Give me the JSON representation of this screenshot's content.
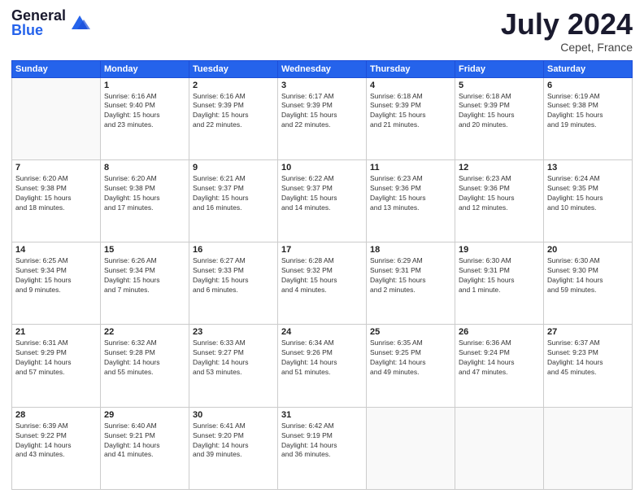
{
  "header": {
    "logo_general": "General",
    "logo_blue": "Blue",
    "month_title": "July 2024",
    "location": "Cepet, France"
  },
  "weekdays": [
    "Sunday",
    "Monday",
    "Tuesday",
    "Wednesday",
    "Thursday",
    "Friday",
    "Saturday"
  ],
  "weeks": [
    [
      {
        "day": "",
        "info": ""
      },
      {
        "day": "1",
        "info": "Sunrise: 6:16 AM\nSunset: 9:40 PM\nDaylight: 15 hours\nand 23 minutes."
      },
      {
        "day": "2",
        "info": "Sunrise: 6:16 AM\nSunset: 9:39 PM\nDaylight: 15 hours\nand 22 minutes."
      },
      {
        "day": "3",
        "info": "Sunrise: 6:17 AM\nSunset: 9:39 PM\nDaylight: 15 hours\nand 22 minutes."
      },
      {
        "day": "4",
        "info": "Sunrise: 6:18 AM\nSunset: 9:39 PM\nDaylight: 15 hours\nand 21 minutes."
      },
      {
        "day": "5",
        "info": "Sunrise: 6:18 AM\nSunset: 9:39 PM\nDaylight: 15 hours\nand 20 minutes."
      },
      {
        "day": "6",
        "info": "Sunrise: 6:19 AM\nSunset: 9:38 PM\nDaylight: 15 hours\nand 19 minutes."
      }
    ],
    [
      {
        "day": "7",
        "info": "Sunrise: 6:20 AM\nSunset: 9:38 PM\nDaylight: 15 hours\nand 18 minutes."
      },
      {
        "day": "8",
        "info": "Sunrise: 6:20 AM\nSunset: 9:38 PM\nDaylight: 15 hours\nand 17 minutes."
      },
      {
        "day": "9",
        "info": "Sunrise: 6:21 AM\nSunset: 9:37 PM\nDaylight: 15 hours\nand 16 minutes."
      },
      {
        "day": "10",
        "info": "Sunrise: 6:22 AM\nSunset: 9:37 PM\nDaylight: 15 hours\nand 14 minutes."
      },
      {
        "day": "11",
        "info": "Sunrise: 6:23 AM\nSunset: 9:36 PM\nDaylight: 15 hours\nand 13 minutes."
      },
      {
        "day": "12",
        "info": "Sunrise: 6:23 AM\nSunset: 9:36 PM\nDaylight: 15 hours\nand 12 minutes."
      },
      {
        "day": "13",
        "info": "Sunrise: 6:24 AM\nSunset: 9:35 PM\nDaylight: 15 hours\nand 10 minutes."
      }
    ],
    [
      {
        "day": "14",
        "info": "Sunrise: 6:25 AM\nSunset: 9:34 PM\nDaylight: 15 hours\nand 9 minutes."
      },
      {
        "day": "15",
        "info": "Sunrise: 6:26 AM\nSunset: 9:34 PM\nDaylight: 15 hours\nand 7 minutes."
      },
      {
        "day": "16",
        "info": "Sunrise: 6:27 AM\nSunset: 9:33 PM\nDaylight: 15 hours\nand 6 minutes."
      },
      {
        "day": "17",
        "info": "Sunrise: 6:28 AM\nSunset: 9:32 PM\nDaylight: 15 hours\nand 4 minutes."
      },
      {
        "day": "18",
        "info": "Sunrise: 6:29 AM\nSunset: 9:31 PM\nDaylight: 15 hours\nand 2 minutes."
      },
      {
        "day": "19",
        "info": "Sunrise: 6:30 AM\nSunset: 9:31 PM\nDaylight: 15 hours\nand 1 minute."
      },
      {
        "day": "20",
        "info": "Sunrise: 6:30 AM\nSunset: 9:30 PM\nDaylight: 14 hours\nand 59 minutes."
      }
    ],
    [
      {
        "day": "21",
        "info": "Sunrise: 6:31 AM\nSunset: 9:29 PM\nDaylight: 14 hours\nand 57 minutes."
      },
      {
        "day": "22",
        "info": "Sunrise: 6:32 AM\nSunset: 9:28 PM\nDaylight: 14 hours\nand 55 minutes."
      },
      {
        "day": "23",
        "info": "Sunrise: 6:33 AM\nSunset: 9:27 PM\nDaylight: 14 hours\nand 53 minutes."
      },
      {
        "day": "24",
        "info": "Sunrise: 6:34 AM\nSunset: 9:26 PM\nDaylight: 14 hours\nand 51 minutes."
      },
      {
        "day": "25",
        "info": "Sunrise: 6:35 AM\nSunset: 9:25 PM\nDaylight: 14 hours\nand 49 minutes."
      },
      {
        "day": "26",
        "info": "Sunrise: 6:36 AM\nSunset: 9:24 PM\nDaylight: 14 hours\nand 47 minutes."
      },
      {
        "day": "27",
        "info": "Sunrise: 6:37 AM\nSunset: 9:23 PM\nDaylight: 14 hours\nand 45 minutes."
      }
    ],
    [
      {
        "day": "28",
        "info": "Sunrise: 6:39 AM\nSunset: 9:22 PM\nDaylight: 14 hours\nand 43 minutes."
      },
      {
        "day": "29",
        "info": "Sunrise: 6:40 AM\nSunset: 9:21 PM\nDaylight: 14 hours\nand 41 minutes."
      },
      {
        "day": "30",
        "info": "Sunrise: 6:41 AM\nSunset: 9:20 PM\nDaylight: 14 hours\nand 39 minutes."
      },
      {
        "day": "31",
        "info": "Sunrise: 6:42 AM\nSunset: 9:19 PM\nDaylight: 14 hours\nand 36 minutes."
      },
      {
        "day": "",
        "info": ""
      },
      {
        "day": "",
        "info": ""
      },
      {
        "day": "",
        "info": ""
      }
    ]
  ]
}
